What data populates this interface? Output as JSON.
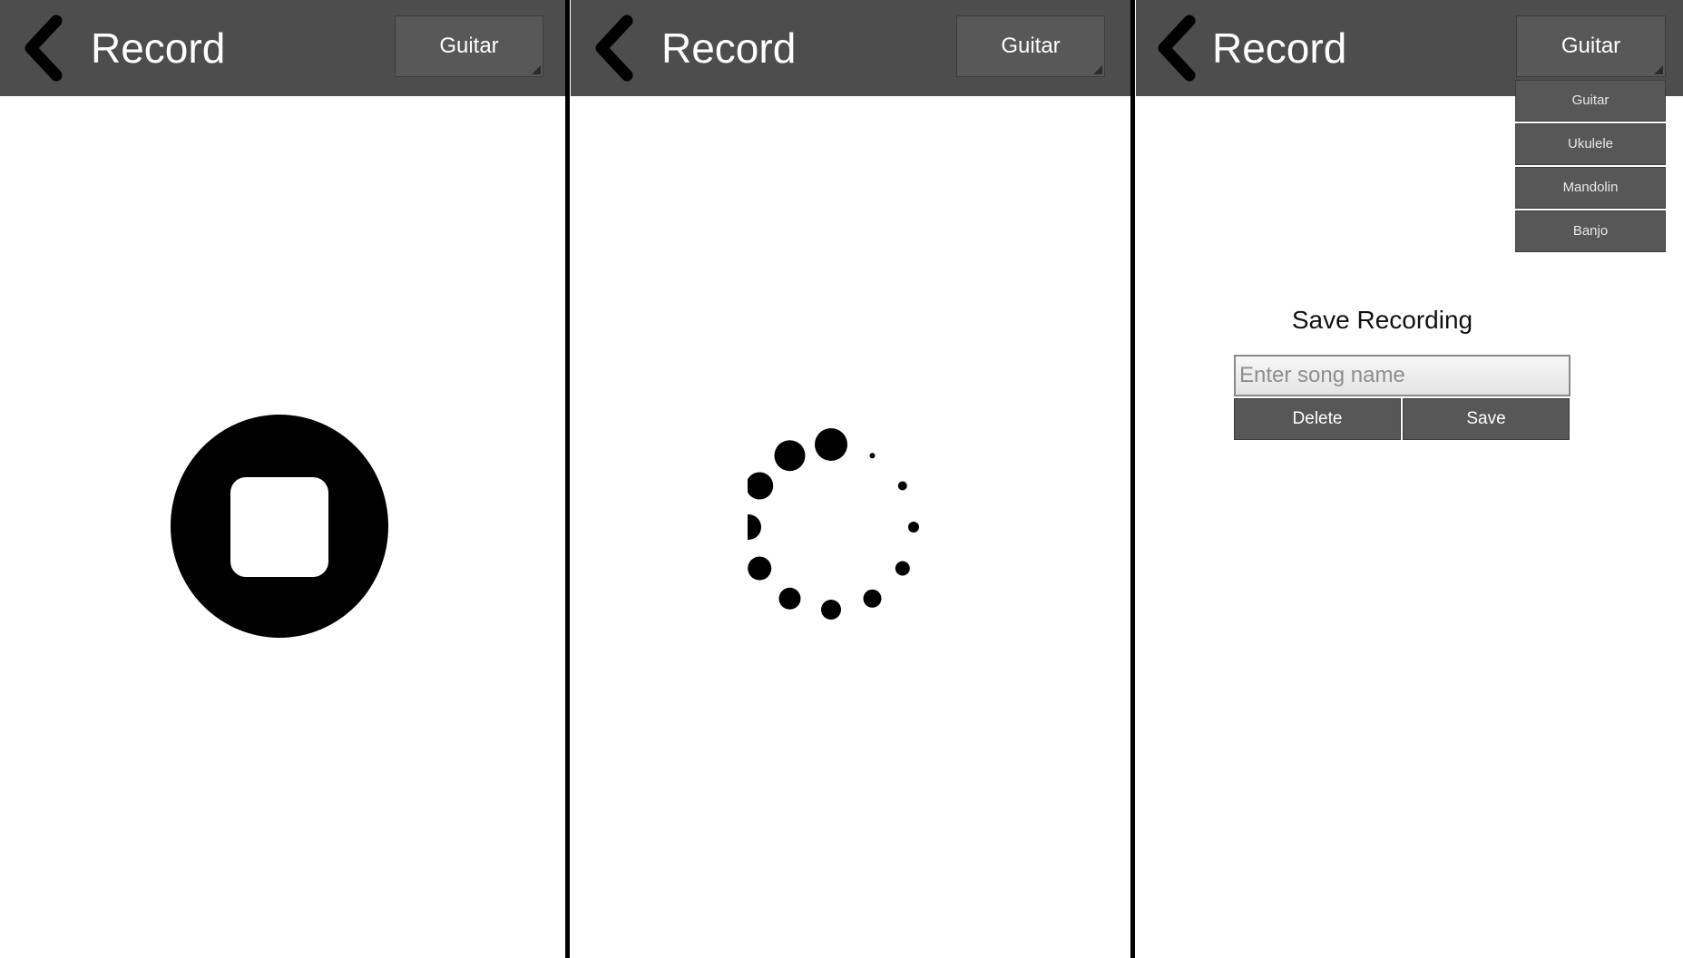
{
  "screens": [
    {
      "header": {
        "title": "Record",
        "instrument_button": "Guitar"
      },
      "state": "recording",
      "main": {
        "control_icon": "stop-icon"
      }
    },
    {
      "header": {
        "title": "Record",
        "instrument_button": "Guitar"
      },
      "state": "processing",
      "main": {
        "indicator_icon": "loading-spinner-icon"
      }
    },
    {
      "header": {
        "title": "Record",
        "instrument_button": "Guitar"
      },
      "state": "save",
      "dropdown": {
        "options": [
          "Guitar",
          "Ukulele",
          "Mandolin",
          "Banjo"
        ]
      },
      "save_dialog": {
        "title": "Save Recording",
        "input_placeholder": "Enter song name",
        "input_value": "",
        "delete_label": "Delete",
        "save_label": "Save"
      }
    }
  ],
  "icons": {
    "back": "chevron-left-icon",
    "stop": "stop-icon",
    "spinner": "loading-spinner-icon"
  },
  "colors": {
    "header_bg": "#4d4d4d",
    "button_bg": "#585858",
    "text_light": "#ffffff",
    "icon_dark": "#000000"
  }
}
